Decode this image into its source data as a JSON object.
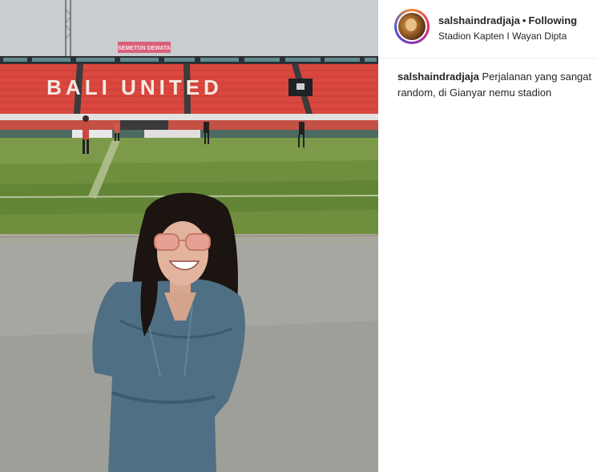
{
  "post": {
    "image_alt": "Woman smiling in sunglasses at Stadion Kapten I Wayan Dipta",
    "stadium_sign_text": "BALI UNITED",
    "banner_text": "SEMETON DEWATA"
  },
  "header": {
    "username": "salshaindradjaja",
    "separator": "•",
    "follow_status": "Following",
    "location": "Stadion Kapten I Wayan Dipta"
  },
  "caption": {
    "username": "salshaindradjaja",
    "text": "Perjalanan yang sangat random, di Gianyar nemu stadion"
  },
  "colors": {
    "stand_red": "#d9473f",
    "grass": "#6f8f3e",
    "dress": "#4f6f85"
  }
}
